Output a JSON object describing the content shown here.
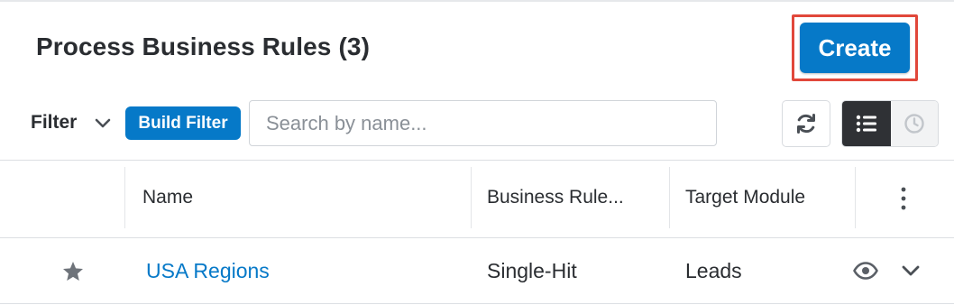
{
  "header": {
    "title": "Process Business Rules",
    "count": "(3)",
    "create_label": "Create"
  },
  "toolbar": {
    "filter_label": "Filter",
    "build_filter_label": "Build Filter",
    "search_placeholder": "Search by name..."
  },
  "table": {
    "columns": [
      "Name",
      "Business Rule...",
      "Target Module"
    ],
    "rows": [
      {
        "name": "USA Regions",
        "type": "Single-Hit",
        "module": "Leads"
      }
    ]
  },
  "icons": {
    "filter_chevron": "chevron-down-icon",
    "refresh": "refresh-icon",
    "list_view": "list-view-icon",
    "activity_view": "clock-icon",
    "column_menu": "kebab-menu-icon",
    "favorite": "star-icon",
    "preview": "eye-icon",
    "row_actions": "chevron-down-icon"
  },
  "colors": {
    "accent": "#0679c8",
    "highlight": "#e1473a",
    "active_toggle": "#2f3135"
  }
}
